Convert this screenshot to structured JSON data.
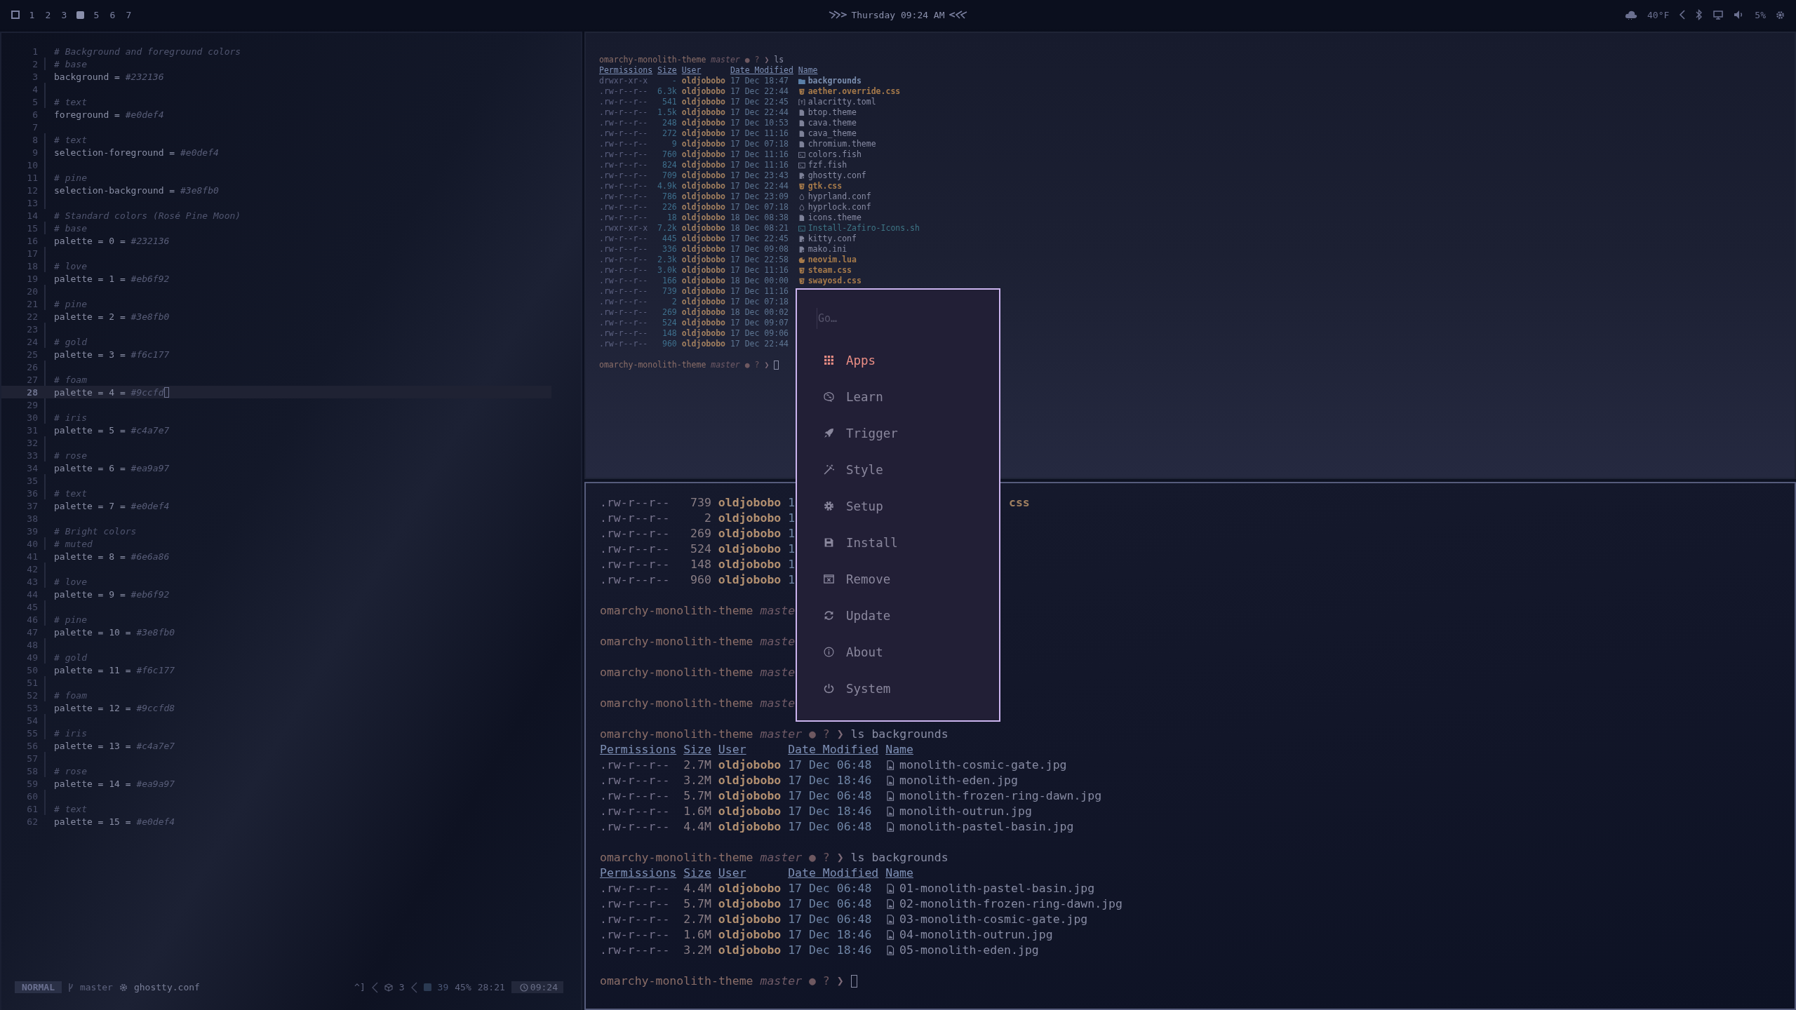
{
  "top_bar": {
    "workspaces": [
      {
        "label": "1",
        "selected": false
      },
      {
        "label": "2",
        "selected": false
      },
      {
        "label": "3",
        "selected": false
      },
      {
        "selected": true
      },
      {
        "label": "5",
        "selected": false
      },
      {
        "label": "6",
        "selected": false
      },
      {
        "label": "7",
        "selected": false
      }
    ],
    "clock": "Thursday 09:24 AM",
    "weather": "40°F",
    "volume": "5%"
  },
  "editor": {
    "lines": [
      {
        "n": "1",
        "kind": "comment",
        "text": "# Background and foreground colors",
        "bar": false,
        "current": false
      },
      {
        "n": "2",
        "kind": "comment",
        "text": "# base",
        "bar": true,
        "current": false
      },
      {
        "n": "3",
        "kind": "assign",
        "code": "background =",
        "value": "#232136",
        "bar": false,
        "current": false
      },
      {
        "n": "4",
        "kind": "blank",
        "bar": true,
        "current": false
      },
      {
        "n": "5",
        "kind": "comment",
        "text": "# text",
        "bar": true,
        "current": false
      },
      {
        "n": "6",
        "kind": "assign",
        "code": "foreground =",
        "value": "#e0def4",
        "bar": false,
        "current": false
      },
      {
        "n": "7",
        "kind": "blank",
        "bar": false,
        "current": false
      },
      {
        "n": "8",
        "kind": "comment",
        "text": "# text",
        "bar": true,
        "current": false
      },
      {
        "n": "9",
        "kind": "assign",
        "code": "selection-foreground =",
        "value": "#e0def4",
        "bar": true,
        "current": false
      },
      {
        "n": "10",
        "kind": "blank",
        "bar": true,
        "current": false
      },
      {
        "n": "11",
        "kind": "comment",
        "text": "# pine",
        "bar": true,
        "current": false
      },
      {
        "n": "12",
        "kind": "assign",
        "code": "selection-background =",
        "value": "#3e8fb0",
        "bar": true,
        "current": false
      },
      {
        "n": "13",
        "kind": "blank",
        "bar": true,
        "current": false
      },
      {
        "n": "14",
        "kind": "comment",
        "text": "# Standard colors (Rosé Pine Moon)",
        "bar": false,
        "current": false
      },
      {
        "n": "15",
        "kind": "comment",
        "text": "# base",
        "bar": true,
        "current": false
      },
      {
        "n": "16",
        "kind": "assign",
        "code": "palette = 0 =",
        "value": "#232136",
        "bar": false,
        "current": false
      },
      {
        "n": "17",
        "kind": "blank",
        "bar": true,
        "current": false
      },
      {
        "n": "18",
        "kind": "comment",
        "text": "# love",
        "bar": true,
        "current": false
      },
      {
        "n": "19",
        "kind": "assign",
        "code": "palette = 1 =",
        "value": "#eb6f92",
        "bar": false,
        "current": false
      },
      {
        "n": "20",
        "kind": "blank",
        "bar": true,
        "current": false
      },
      {
        "n": "21",
        "kind": "comment",
        "text": "# pine",
        "bar": true,
        "current": false
      },
      {
        "n": "22",
        "kind": "assign",
        "code": "palette = 2 =",
        "value": "#3e8fb0",
        "bar": false,
        "current": false
      },
      {
        "n": "23",
        "kind": "blank",
        "bar": true,
        "current": false
      },
      {
        "n": "24",
        "kind": "comment",
        "text": "# gold",
        "bar": true,
        "current": false
      },
      {
        "n": "25",
        "kind": "assign",
        "code": "palette = 3 =",
        "value": "#f6c177",
        "bar": false,
        "current": false
      },
      {
        "n": "26",
        "kind": "blank",
        "bar": true,
        "current": false
      },
      {
        "n": "27",
        "kind": "comment",
        "text": "# foam",
        "bar": true,
        "current": false
      },
      {
        "n": "28",
        "kind": "assign",
        "code": "palette = 4 =",
        "value": "#9ccfd",
        "bar": false,
        "current": true
      },
      {
        "n": "29",
        "kind": "blank",
        "bar": true,
        "current": false
      },
      {
        "n": "30",
        "kind": "comment",
        "text": "# iris",
        "bar": true,
        "current": false
      },
      {
        "n": "31",
        "kind": "assign",
        "code": "palette = 5 =",
        "value": "#c4a7e7",
        "bar": false,
        "current": false
      },
      {
        "n": "32",
        "kind": "blank",
        "bar": true,
        "current": false
      },
      {
        "n": "33",
        "kind": "comment",
        "text": "# rose",
        "bar": true,
        "current": false
      },
      {
        "n": "34",
        "kind": "assign",
        "code": "palette = 6 =",
        "value": "#ea9a97",
        "bar": false,
        "current": false
      },
      {
        "n": "35",
        "kind": "blank",
        "bar": true,
        "current": false
      },
      {
        "n": "36",
        "kind": "comment",
        "text": "# text",
        "bar": true,
        "current": false
      },
      {
        "n": "37",
        "kind": "assign",
        "code": "palette = 7 =",
        "value": "#e0def4",
        "bar": false,
        "current": false
      },
      {
        "n": "38",
        "kind": "blank",
        "bar": false,
        "current": false
      },
      {
        "n": "39",
        "kind": "comment",
        "text": "# Bright colors",
        "bar": false,
        "current": false
      },
      {
        "n": "40",
        "kind": "comment",
        "text": "# muted",
        "bar": true,
        "current": false
      },
      {
        "n": "41",
        "kind": "assign",
        "code": "palette = 8 =",
        "value": "#6e6a86",
        "bar": false,
        "current": false
      },
      {
        "n": "42",
        "kind": "blank",
        "bar": true,
        "current": false
      },
      {
        "n": "43",
        "kind": "comment",
        "text": "# love",
        "bar": true,
        "current": false
      },
      {
        "n": "44",
        "kind": "assign",
        "code": "palette = 9 =",
        "value": "#eb6f92",
        "bar": false,
        "current": false
      },
      {
        "n": "45",
        "kind": "blank",
        "bar": true,
        "current": false
      },
      {
        "n": "46",
        "kind": "comment",
        "text": "# pine",
        "bar": true,
        "current": false
      },
      {
        "n": "47",
        "kind": "assign",
        "code": "palette = 10 =",
        "value": "#3e8fb0",
        "bar": false,
        "current": false
      },
      {
        "n": "48",
        "kind": "blank",
        "bar": true,
        "current": false
      },
      {
        "n": "49",
        "kind": "comment",
        "text": "# gold",
        "bar": true,
        "current": false
      },
      {
        "n": "50",
        "kind": "assign",
        "code": "palette = 11 =",
        "value": "#f6c177",
        "bar": false,
        "current": false
      },
      {
        "n": "51",
        "kind": "blank",
        "bar": true,
        "current": false
      },
      {
        "n": "52",
        "kind": "comment",
        "text": "# foam",
        "bar": true,
        "current": false
      },
      {
        "n": "53",
        "kind": "assign",
        "code": "palette = 12 =",
        "value": "#9ccfd8",
        "bar": false,
        "current": false
      },
      {
        "n": "54",
        "kind": "blank",
        "bar": true,
        "current": false
      },
      {
        "n": "55",
        "kind": "comment",
        "text": "# iris",
        "bar": true,
        "current": false
      },
      {
        "n": "56",
        "kind": "assign",
        "code": "palette = 13 =",
        "value": "#c4a7e7",
        "bar": false,
        "current": false
      },
      {
        "n": "57",
        "kind": "blank",
        "bar": true,
        "current": false
      },
      {
        "n": "58",
        "kind": "comment",
        "text": "# rose",
        "bar": true,
        "current": false
      },
      {
        "n": "59",
        "kind": "assign",
        "code": "palette = 14 =",
        "value": "#ea9a97",
        "bar": false,
        "current": false
      },
      {
        "n": "60",
        "kind": "blank",
        "bar": true,
        "current": false
      },
      {
        "n": "61",
        "kind": "comment",
        "text": "# text",
        "bar": true,
        "current": false
      },
      {
        "n": "62",
        "kind": "assign",
        "code": "palette = 15 =",
        "value": "#e0def4",
        "bar": false,
        "current": false
      }
    ],
    "status_bar": {
      "mode": "NORMAL",
      "branch": "master",
      "file": "ghostty.conf",
      "keys": "^]",
      "count_a": "3",
      "count_b": "39",
      "percent": "45%",
      "position": "28:21",
      "time": "09:24"
    }
  },
  "top_terminal": {
    "lines": [
      {
        "kind": "prompt",
        "dir": "omarchy-monolith-theme",
        "branch": "master",
        "marks": "● ?",
        "arrow": "❯",
        "command": "ls",
        "cursor": false
      },
      {
        "kind": "header",
        "columns": [
          "Permissions",
          "Size",
          "User",
          "Date Modified",
          "Name"
        ]
      },
      {
        "kind": "dir",
        "perms": "drwxr-xr-x",
        "size": "-",
        "user": "oldjobobo",
        "date": "17 Dec 18:47",
        "name": "backgrounds"
      },
      {
        "kind": "css",
        "perms": ".rw-r--r--",
        "size": "6.3k",
        "user": "oldjobobo",
        "date": "17 Dec 22:44",
        "name": "aether.override.css"
      },
      {
        "kind": "toml",
        "perms": ".rw-r--r--",
        "size": "541",
        "user": "oldjobobo",
        "date": "17 Dec 22:45",
        "name": "alacritty.toml"
      },
      {
        "kind": "file",
        "perms": ".rw-r--r--",
        "size": "1.5k",
        "user": "oldjobobo",
        "date": "17 Dec 22:44",
        "name": "btop.theme"
      },
      {
        "kind": "file",
        "perms": ".rw-r--r--",
        "size": "248",
        "user": "oldjobobo",
        "date": "17 Dec 10:53",
        "name": "cava.theme"
      },
      {
        "kind": "file",
        "perms": ".rw-r--r--",
        "size": "272",
        "user": "oldjobobo",
        "date": "17 Dec 11:16",
        "name": "cava_theme"
      },
      {
        "kind": "file",
        "perms": ".rw-r--r--",
        "size": "9",
        "user": "oldjobobo",
        "date": "17 Dec 07:18",
        "name": "chromium.theme"
      },
      {
        "kind": "shell",
        "perms": ".rw-r--r--",
        "size": "760",
        "user": "oldjobobo",
        "date": "17 Dec 11:16",
        "name": "colors.fish"
      },
      {
        "kind": "shell",
        "perms": ".rw-r--r--",
        "size": "824",
        "user": "oldjobobo",
        "date": "17 Dec 11:16",
        "name": "fzf.fish"
      },
      {
        "kind": "config",
        "perms": ".rw-r--r--",
        "size": "709",
        "user": "oldjobobo",
        "date": "17 Dec 23:43",
        "name": "ghostty.conf"
      },
      {
        "kind": "css",
        "perms": ".rw-r--r--",
        "size": "4.9k",
        "user": "oldjobobo",
        "date": "17 Dec 22:44",
        "name": "gtk.css"
      },
      {
        "kind": "drop",
        "perms": ".rw-r--r--",
        "size": "786",
        "user": "oldjobobo",
        "date": "17 Dec 23:09",
        "name": "hyprland.conf"
      },
      {
        "kind": "drop",
        "perms": ".rw-r--r--",
        "size": "226",
        "user": "oldjobobo",
        "date": "17 Dec 07:18",
        "name": "hyprlock.conf"
      },
      {
        "kind": "file",
        "perms": ".rw-r--r--",
        "size": "18",
        "user": "oldjobobo",
        "date": "18 Dec 08:38",
        "name": "icons.theme"
      },
      {
        "kind": "exec",
        "perms": ".rwxr-xr-x",
        "size": "7.2k",
        "user": "oldjobobo",
        "date": "18 Dec 08:21",
        "name": "Install-Zafiro-Icons.sh"
      },
      {
        "kind": "config",
        "perms": ".rw-r--r--",
        "size": "445",
        "user": "oldjobobo",
        "date": "17 Dec 22:45",
        "name": "kitty.conf"
      },
      {
        "kind": "config",
        "perms": ".rw-r--r--",
        "size": "336",
        "user": "oldjobobo",
        "date": "17 Dec 09:08",
        "name": "mako.ini"
      },
      {
        "kind": "lua",
        "perms": ".rw-r--r--",
        "size": "2.3k",
        "user": "oldjobobo",
        "date": "17 Dec 22:58",
        "name": "neovim.lua"
      },
      {
        "kind": "css",
        "perms": ".rw-r--r--",
        "size": "3.0k",
        "user": "oldjobobo",
        "date": "17 Dec 11:16",
        "name": "steam.css"
      },
      {
        "kind": "css",
        "perms": ".rw-r--r--",
        "size": "166",
        "user": "oldjobobo",
        "date": "18 Dec 00:00",
        "name": "swayosd.css"
      },
      {
        "kind": "row",
        "perms": ".rw-r--r--",
        "size": "739",
        "user": "oldjobobo",
        "date": "17 Dec 11:16"
      },
      {
        "kind": "row",
        "perms": ".rw-r--r--",
        "size": "2",
        "user": "oldjobobo",
        "date": "17 Dec 07:18"
      },
      {
        "kind": "row",
        "perms": ".rw-r--r--",
        "size": "269",
        "user": "oldjobobo",
        "date": "18 Dec 00:02"
      },
      {
        "kind": "row",
        "perms": ".rw-r--r--",
        "size": "524",
        "user": "oldjobobo",
        "date": "17 Dec 09:07"
      },
      {
        "kind": "row",
        "perms": ".rw-r--r--",
        "size": "148",
        "user": "oldjobobo",
        "date": "17 Dec 09:06"
      },
      {
        "kind": "row",
        "perms": ".rw-r--r--",
        "size": "960",
        "user": "oldjobobo",
        "date": "17 Dec 22:44"
      },
      {
        "kind": "prompt",
        "dir": "omarchy-monolith-theme",
        "branch": "master",
        "marks": "● ?",
        "arrow": "❯",
        "cursor": true
      }
    ]
  },
  "bottom_terminal": {
    "lines": [
      {
        "kind": "row",
        "perms": ".rw-r--r--",
        "size": "739",
        "user": "oldjobobo",
        "date": "1",
        "tail": "css"
      },
      {
        "kind": "row",
        "perms": ".rw-r--r--",
        "size": "2",
        "user": "oldjobobo",
        "date": "1"
      },
      {
        "kind": "row",
        "perms": ".rw-r--r--",
        "size": "269",
        "user": "oldjobobo",
        "date": "1"
      },
      {
        "kind": "row",
        "perms": ".rw-r--r--",
        "size": "524",
        "user": "oldjobobo",
        "date": "1"
      },
      {
        "kind": "row",
        "perms": ".rw-r--r--",
        "size": "148",
        "user": "oldjobobo",
        "date": "1"
      },
      {
        "kind": "row",
        "perms": ".rw-r--r--",
        "size": "960",
        "user": "oldjobobo",
        "date": "1"
      },
      {
        "kind": "prompt",
        "dir": "omarchy-monolith-theme",
        "branch": "maste",
        "cursor": false
      },
      {
        "kind": "prompt",
        "dir": "omarchy-monolith-theme",
        "branch": "maste",
        "cursor": false
      },
      {
        "kind": "prompt",
        "dir": "omarchy-monolith-theme",
        "branch": "maste",
        "cursor": false
      },
      {
        "kind": "prompt",
        "dir": "omarchy-monolith-theme",
        "branch": "maste",
        "cursor": false
      },
      {
        "kind": "prompt",
        "dir": "omarchy-monolith-theme",
        "branch": "master",
        "marks": "● ?",
        "arrow": "❯",
        "command": "ls backgrounds",
        "cursor": false
      },
      {
        "kind": "header",
        "columns": [
          "Permissions",
          "Size",
          "User",
          "Date Modified",
          "Name"
        ]
      },
      {
        "kind": "image",
        "perms": ".rw-r--r--",
        "size": "2.7M",
        "user": "oldjobobo",
        "date": "17 Dec 06:48",
        "name": "monolith-cosmic-gate.jpg"
      },
      {
        "kind": "image",
        "perms": ".rw-r--r--",
        "size": "3.2M",
        "user": "oldjobobo",
        "date": "17 Dec 18:46",
        "name": "monolith-eden.jpg"
      },
      {
        "kind": "image",
        "perms": ".rw-r--r--",
        "size": "5.7M",
        "user": "oldjobobo",
        "date": "17 Dec 06:48",
        "name": "monolith-frozen-ring-dawn.jpg"
      },
      {
        "kind": "image",
        "perms": ".rw-r--r--",
        "size": "1.6M",
        "user": "oldjobobo",
        "date": "17 Dec 18:46",
        "name": "monolith-outrun.jpg"
      },
      {
        "kind": "image",
        "perms": ".rw-r--r--",
        "size": "4.4M",
        "user": "oldjobobo",
        "date": "17 Dec 06:48",
        "name": "monolith-pastel-basin.jpg"
      },
      {
        "kind": "prompt",
        "dir": "omarchy-monolith-theme",
        "branch": "master",
        "marks": "● ?",
        "arrow": "❯",
        "command": "ls backgrounds",
        "cursor": false
      },
      {
        "kind": "header",
        "columns": [
          "Permissions",
          "Size",
          "User",
          "Date Modified",
          "Name"
        ]
      },
      {
        "kind": "image",
        "perms": ".rw-r--r--",
        "size": "4.4M",
        "user": "oldjobobo",
        "date": "17 Dec 06:48",
        "name": "01-monolith-pastel-basin.jpg"
      },
      {
        "kind": "image",
        "perms": ".rw-r--r--",
        "size": "5.7M",
        "user": "oldjobobo",
        "date": "17 Dec 06:48",
        "name": "02-monolith-frozen-ring-dawn.jpg"
      },
      {
        "kind": "image",
        "perms": ".rw-r--r--",
        "size": "2.7M",
        "user": "oldjobobo",
        "date": "17 Dec 06:48",
        "name": "03-monolith-cosmic-gate.jpg"
      },
      {
        "kind": "image",
        "perms": ".rw-r--r--",
        "size": "1.6M",
        "user": "oldjobobo",
        "date": "17 Dec 18:46",
        "name": "04-monolith-outrun.jpg"
      },
      {
        "kind": "image",
        "perms": ".rw-r--r--",
        "size": "3.2M",
        "user": "oldjobobo",
        "date": "17 Dec 18:46",
        "name": "05-monolith-eden.jpg"
      },
      {
        "kind": "prompt",
        "dir": "omarchy-monolith-theme",
        "branch": "master",
        "marks": "● ?",
        "arrow": "❯",
        "cursor": true
      }
    ]
  },
  "menu": {
    "placeholder": "Go…",
    "items": [
      {
        "label": "Apps",
        "selected": true
      },
      {
        "label": "Learn",
        "selected": false
      },
      {
        "label": "Trigger",
        "selected": false
      },
      {
        "label": "Style",
        "selected": false
      },
      {
        "label": "Setup",
        "selected": false
      },
      {
        "label": "Install",
        "selected": false
      },
      {
        "label": "Remove",
        "selected": false
      },
      {
        "label": "Update",
        "selected": false
      },
      {
        "label": "About",
        "selected": false
      },
      {
        "label": "System",
        "selected": false
      }
    ]
  }
}
